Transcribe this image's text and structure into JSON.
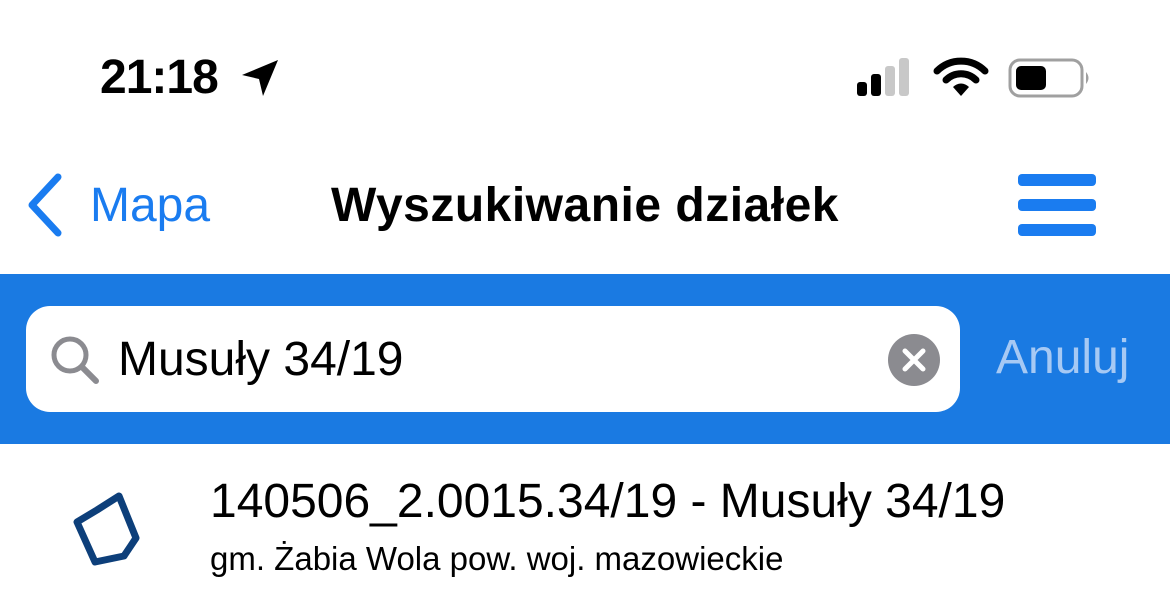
{
  "status_bar": {
    "time": "21:18",
    "icons": [
      "location-arrow-icon",
      "cellular-signal-icon",
      "wifi-icon",
      "battery-icon"
    ]
  },
  "nav": {
    "back_label": "Mapa",
    "title": "Wyszukiwanie działek",
    "menu_icon": "hamburger-menu-icon"
  },
  "search": {
    "value": "Musuły 34/19",
    "cancel_label": "Anuluj"
  },
  "results": [
    {
      "title": "140506_2.0015.34/19 - Musuły 34/19",
      "subtitle": "gm. Żabia Wola pow.  woj. mazowieckie",
      "icon": "parcel-polygon-icon"
    }
  ],
  "colors": {
    "accent": "#1a7cf0",
    "search_bar_bg": "#1a7ae2",
    "cancel_text": "#a6c9f4",
    "parcel_stroke": "#0d3f7a"
  }
}
